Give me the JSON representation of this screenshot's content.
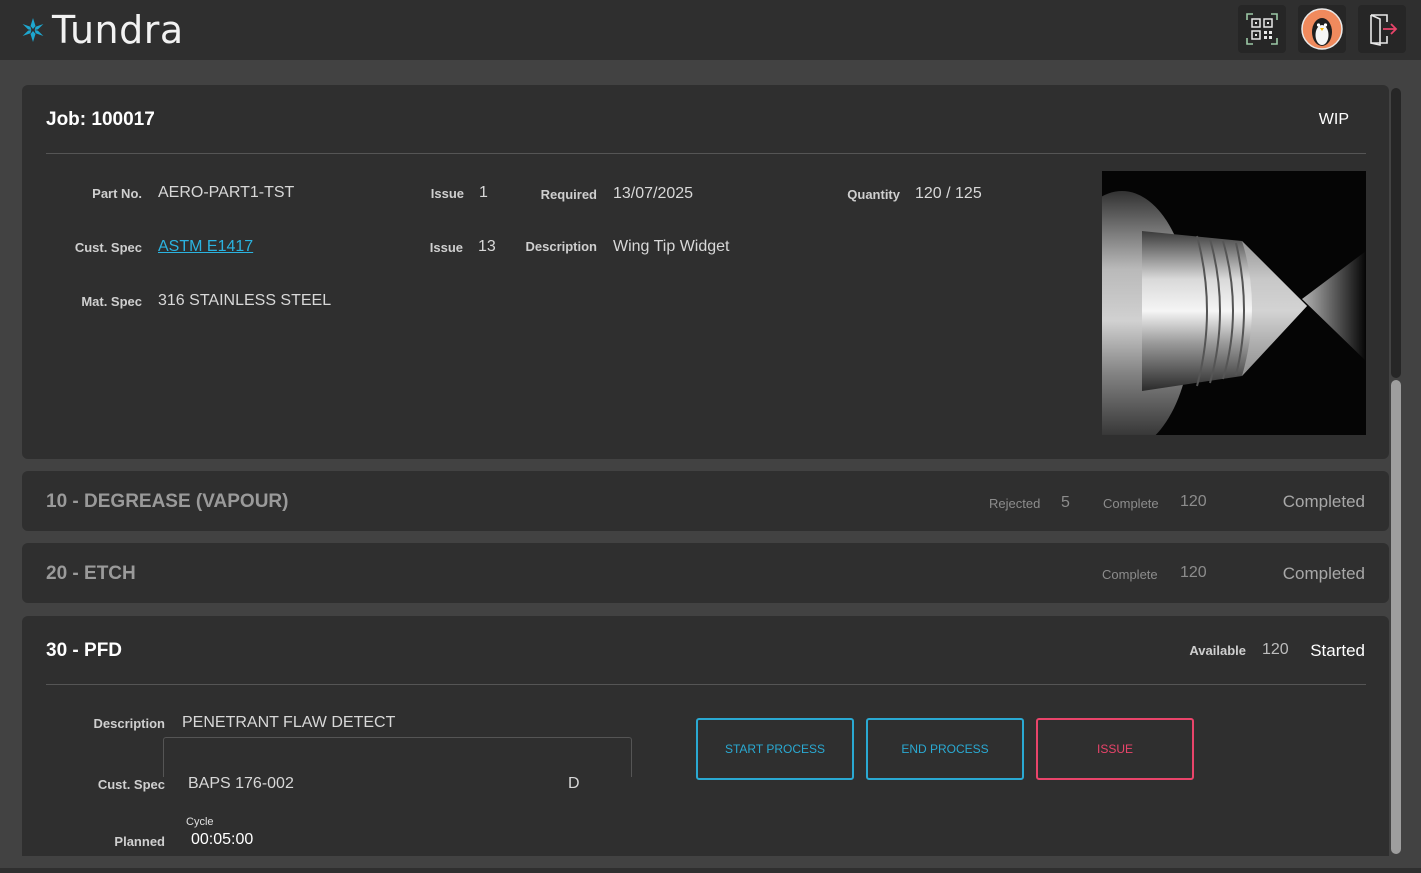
{
  "app": {
    "title": "Tundra"
  },
  "job": {
    "title": "Job: 100017",
    "status": "WIP",
    "part_no_label": "Part No.",
    "part_no": "AERO-PART1-TST",
    "issue_label": "Issue",
    "part_issue": "1",
    "required_label": "Required",
    "required": "13/07/2025",
    "quantity_label": "Quantity",
    "quantity": "120 / 125",
    "cust_spec_label": "Cust. Spec",
    "cust_spec": "ASTM E1417",
    "cust_issue": "13",
    "description_label": "Description",
    "description": "Wing Tip Widget",
    "mat_spec_label": "Mat. Spec",
    "mat_spec": "316 STAINLESS STEEL"
  },
  "operations": [
    {
      "title": "10 - DEGREASE (VAPOUR)",
      "rejected_label": "Rejected",
      "rejected": "5",
      "complete_label": "Complete",
      "complete": "120",
      "status": "Completed"
    },
    {
      "title": "20 - ETCH",
      "complete_label": "Complete",
      "complete": "120",
      "status": "Completed"
    },
    {
      "title": "30 - PFD",
      "available_label": "Available",
      "available": "120",
      "status": "Started",
      "description_label": "Description",
      "description": "PENETRANT FLAW DETECT",
      "cust_spec_label": "Cust. Spec",
      "cust_spec": "BAPS 176-002",
      "cust_spec_issue": "D",
      "planned_label": "Planned",
      "cycle_label": "Cycle",
      "cycle_value": "00:05:00",
      "buttons": {
        "start": "START PROCESS",
        "end": "END PROCESS",
        "issue": "ISSUE"
      }
    }
  ],
  "colors": {
    "accent": "#2aa9d2",
    "danger": "#e9446a",
    "card": "#2f2f2f",
    "background": "#424242"
  }
}
